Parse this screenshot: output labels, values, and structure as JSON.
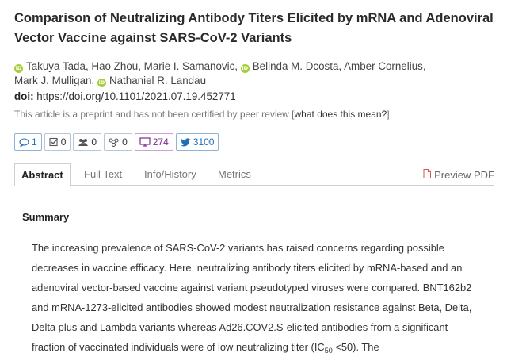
{
  "article": {
    "title": "Comparison of Neutralizing Antibody Titers Elicited by mRNA and Adenoviral Vector Vaccine against SARS-CoV-2 Variants",
    "authors": [
      {
        "name": "Takuya Tada",
        "orcid": true
      },
      {
        "name": "Hao Zhou",
        "orcid": false
      },
      {
        "name": "Marie I. Samanovic",
        "orcid": false
      },
      {
        "name": "Belinda M. Dcosta",
        "orcid": true
      },
      {
        "name": "Amber Cornelius",
        "orcid": false
      },
      {
        "name": "Mark J. Mulligan",
        "orcid": false
      },
      {
        "name": "Nathaniel R. Landau",
        "orcid": true
      }
    ],
    "orcid_glyph": "iD",
    "doi_label": "doi:",
    "doi_value": "https://doi.org/10.1101/2021.07.19.452771",
    "preprint_notice": "This article is a preprint and has not been certified by peer review [",
    "preprint_link": "what does this mean?",
    "preprint_end": "]."
  },
  "metrics": [
    {
      "icon": "comment-icon",
      "value": "1",
      "style": "blue"
    },
    {
      "icon": "checkbox-icon",
      "value": "0",
      "style": "default"
    },
    {
      "icon": "people-icon",
      "value": "0",
      "style": "default"
    },
    {
      "icon": "network-icon",
      "value": "0",
      "style": "default"
    },
    {
      "icon": "monitor-icon",
      "value": "274",
      "style": "purple"
    },
    {
      "icon": "twitter-icon",
      "value": "3100",
      "style": "blue"
    }
  ],
  "tabs": {
    "abstract": "Abstract",
    "full_text": "Full Text",
    "info_history": "Info/History",
    "metrics": "Metrics",
    "preview_pdf": "Preview PDF"
  },
  "summary": {
    "heading": "Summary",
    "text_part1": "The increasing prevalence of SARS-CoV-2 variants has raised concerns regarding possible decreases in vaccine efficacy. Here, neutralizing antibody titers elicited by mRNA-based and an adenoviral vector-based vaccine against variant pseudotyped viruses were compared. BNT162b2 and mRNA-1273-elicited antibodies showed modest neutralization resistance against Beta, Delta, Delta plus and Lambda variants whereas Ad26.COV2.S-elicited antibodies from a significant fraction of vaccinated individuals were of low neutralizing titer (IC",
    "text_sub": "50",
    "text_part2": " <50). The"
  },
  "colors": {
    "orcid_green": "#a6ce39",
    "link_blue": "#1f6fb5",
    "altmetric_purple": "#7b2c8e",
    "pdf_red": "#d9534f"
  }
}
